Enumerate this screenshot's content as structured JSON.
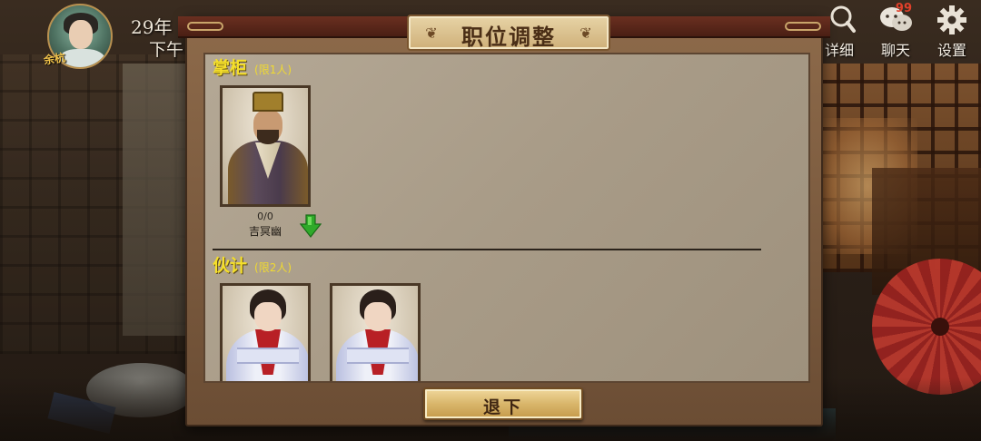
{
  "hud": {
    "player_name": "余杭",
    "date_text": "29年",
    "time_text": "下午",
    "detail_label": "详细",
    "chat_label": "聊天",
    "chat_badge": "99",
    "settings_label": "设置"
  },
  "dialog": {
    "title": "职位调整",
    "sections": [
      {
        "title": "掌柜",
        "limit": "(限1人)",
        "members": [
          {
            "stat": "0/0",
            "name": "吉冥幽"
          }
        ]
      },
      {
        "title": "伙计",
        "limit": "(限2人)",
        "members": [
          {},
          {}
        ]
      }
    ],
    "dismiss_label": "退下"
  },
  "colors": {
    "section_title": "#f5df2a",
    "dialog_body": "#a89b87",
    "button_gold": "#d9b66b",
    "arrow_green": "#2faa2a"
  },
  "icons": [
    "search-icon",
    "chat-icon",
    "gear-icon",
    "swirl-ornament-icon",
    "down-arrow-icon"
  ]
}
